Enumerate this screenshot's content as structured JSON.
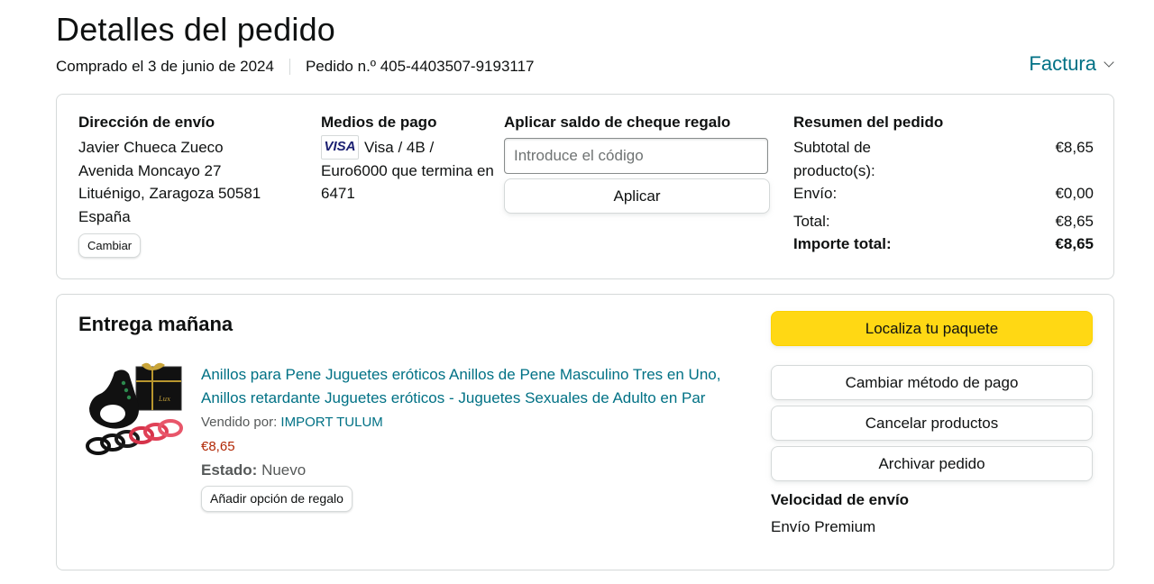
{
  "header": {
    "title": "Detalles del pedido",
    "purchased": "Comprado el 3 de junio de 2024",
    "order_number": "Pedido n.º 405-4403507-9193117",
    "invoice_label": "Factura"
  },
  "shipping": {
    "heading": "Dirección de envío",
    "lines": [
      "Javier Chueca Zueco",
      "Avenida Moncayo 27",
      "Lituénigo, Zaragoza 50581",
      "España"
    ],
    "change_label": "Cambiar"
  },
  "payment": {
    "heading": "Medios de pago",
    "card_brand": "VISA",
    "description": "Visa / 4B / Euro6000 que termina en 6471"
  },
  "gift_card": {
    "heading": "Aplicar saldo de cheque regalo",
    "placeholder": "Introduce el código",
    "apply_label": "Aplicar"
  },
  "summary": {
    "heading": "Resumen del pedido",
    "rows": [
      {
        "label": "Subtotal de producto(s):",
        "value": "€8,65"
      },
      {
        "label": "Envío:",
        "value": "€0,00"
      },
      {
        "label": "Total:",
        "value": "€8,65"
      }
    ],
    "grand_total_label": "Importe total:",
    "grand_total_value": "€8,65"
  },
  "delivery": {
    "title": "Entrega mañana",
    "product": {
      "title": "Anillos para Pene Juguetes eróticos Anillos de Pene Masculino Tres en Uno, Anillos retardante Juguetes eróticos - Juguetes Sexuales de Adulto en Par",
      "sold_by_label": "Vendido por:",
      "seller": "IMPORT TULUM",
      "price": "€8,65",
      "status_label": "Estado:",
      "status_value": "Nuevo",
      "gift_option_label": "Añadir opción de regalo"
    },
    "actions": {
      "track": "Localiza tu paquete",
      "change_payment": "Cambiar método de pago",
      "cancel": "Cancelar productos",
      "archive": "Archivar pedido"
    },
    "speed_heading": "Velocidad de envío",
    "speed_value": "Envío Premium"
  },
  "colors": {
    "link": "#007185",
    "primary_button": "#ffd814",
    "price": "#b12704",
    "border": "#d5d9d9"
  }
}
